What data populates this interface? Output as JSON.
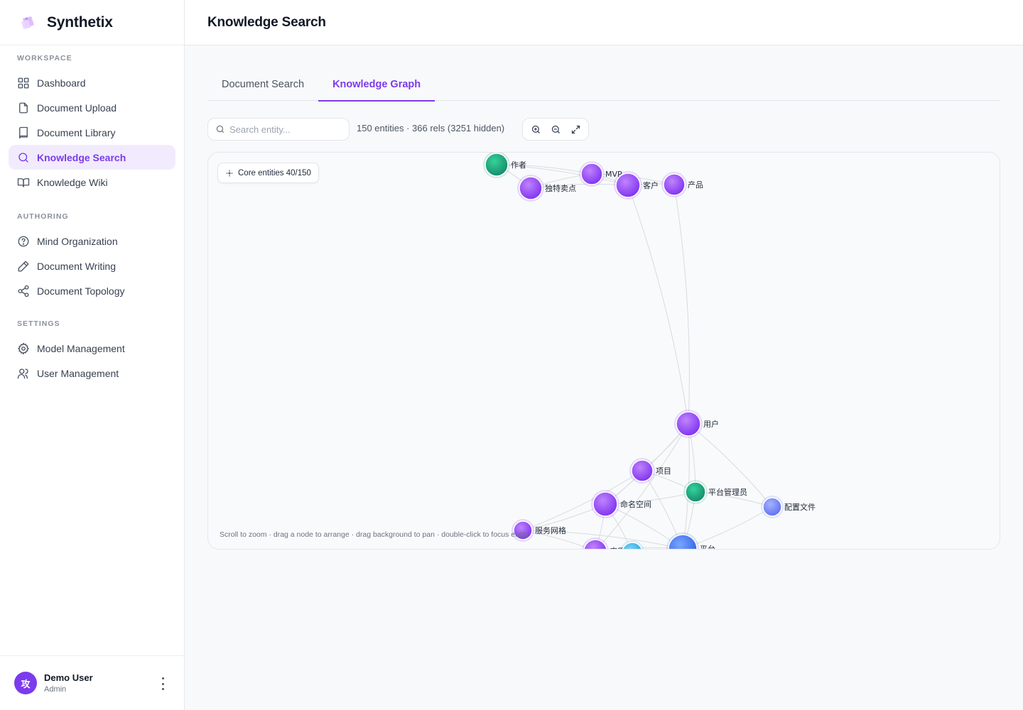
{
  "app": {
    "name": "Synthetix"
  },
  "sidebar": {
    "sections": [
      {
        "title": "WORKSPACE",
        "items": [
          {
            "label": "Dashboard",
            "icon": "grid-icon",
            "active": false
          },
          {
            "label": "Document Upload",
            "icon": "file-icon",
            "active": false
          },
          {
            "label": "Document Library",
            "icon": "book-icon",
            "active": false
          },
          {
            "label": "Knowledge Search",
            "icon": "search-icon",
            "active": true
          },
          {
            "label": "Knowledge Wiki",
            "icon": "open-book-icon",
            "active": false
          }
        ]
      },
      {
        "title": "AUTHORING",
        "items": [
          {
            "label": "Mind Organization",
            "icon": "help-circle-icon",
            "active": false
          },
          {
            "label": "Document Writing",
            "icon": "pencil-icon",
            "active": false
          },
          {
            "label": "Document Topology",
            "icon": "share-icon",
            "active": false
          }
        ]
      },
      {
        "title": "SETTINGS",
        "items": [
          {
            "label": "Model Management",
            "icon": "gear-icon",
            "active": false
          },
          {
            "label": "User Management",
            "icon": "users-icon",
            "active": false
          }
        ]
      }
    ],
    "user": {
      "avatar_text": "攻",
      "name": "Demo User",
      "role": "Admin"
    }
  },
  "header": {
    "title": "Knowledge Search"
  },
  "tabs": [
    {
      "label": "Document Search",
      "active": false
    },
    {
      "label": "Knowledge Graph",
      "active": true
    }
  ],
  "toolbar": {
    "search_placeholder": "Search entity...",
    "stats": "150 entities · 366 rels  (3251 hidden)",
    "zoom_in_icon": "zoom-in-icon",
    "zoom_out_icon": "zoom-out-icon",
    "fullscreen_icon": "expand-icon"
  },
  "graph": {
    "core_badge": "Core entities 40/150",
    "hint": "Scroll to zoom · drag a node to arrange · drag background to pan · double-click to focus entity",
    "colors": {
      "purple": "#8b3dff",
      "green": "#1f9e73",
      "blue": "#3b6cf0",
      "periwinkle": "#6d7cf2",
      "cyan": "#2bb3e6",
      "edge": "#d9dbe0"
    },
    "nodes": [
      {
        "id": "author",
        "label": "作者",
        "color": "green"
      },
      {
        "id": "mvp",
        "label": "MVP",
        "color": "purple"
      },
      {
        "id": "usp",
        "label": "独特卖点",
        "color": "purple"
      },
      {
        "id": "customer",
        "label": "客户",
        "color": "purple"
      },
      {
        "id": "product",
        "label": "产品",
        "color": "purple"
      },
      {
        "id": "user",
        "label": "用户",
        "color": "purple"
      },
      {
        "id": "project",
        "label": "项目",
        "color": "purple"
      },
      {
        "id": "admin",
        "label": "平台管理员",
        "color": "green"
      },
      {
        "id": "config",
        "label": "配置文件",
        "color": "periwinkle"
      },
      {
        "id": "namespace",
        "label": "命名空间",
        "color": "purple"
      },
      {
        "id": "mesh",
        "label": "服务网格",
        "color": "purple"
      },
      {
        "id": "app",
        "label": "应用",
        "color": "purple"
      },
      {
        "id": "cyan1",
        "label": "",
        "color": "cyan"
      },
      {
        "id": "platform",
        "label": "平台",
        "color": "blue"
      }
    ]
  }
}
